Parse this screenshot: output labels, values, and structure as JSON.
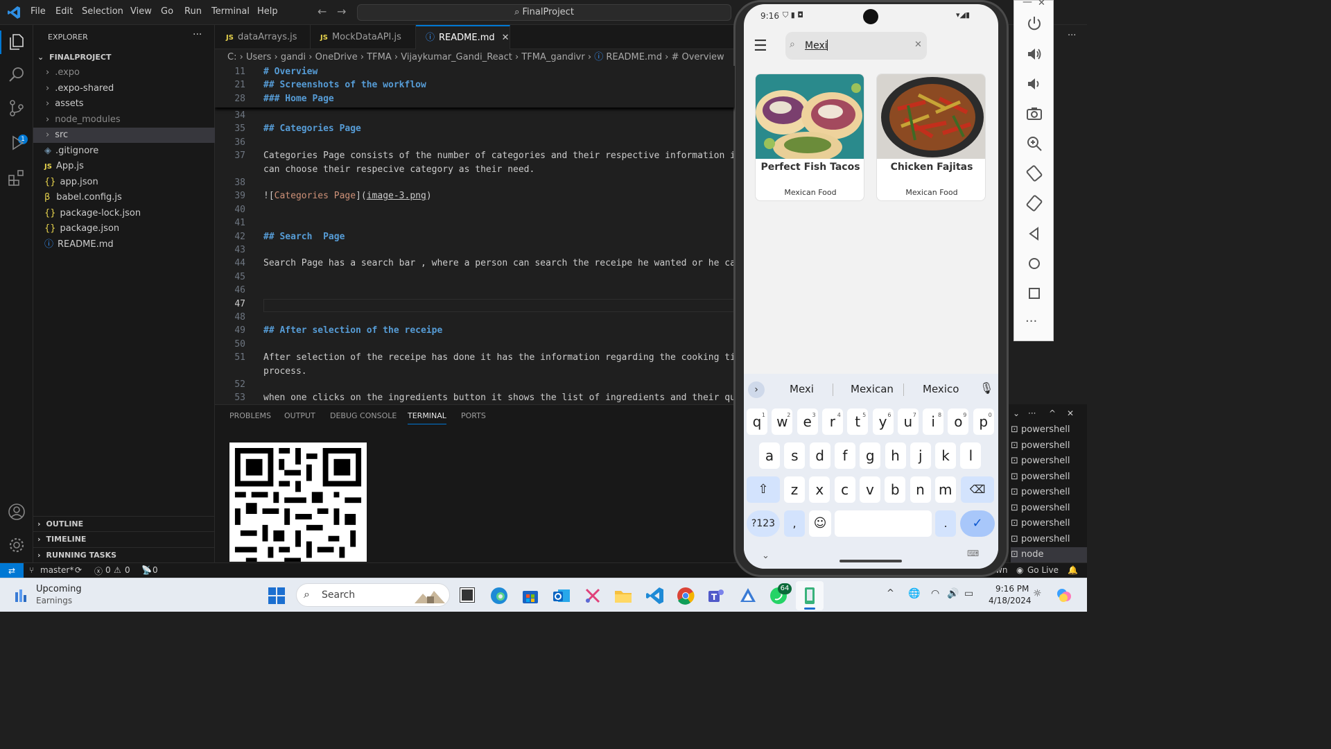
{
  "titlebar": {
    "menu": [
      "File",
      "Edit",
      "Selection",
      "View",
      "Go",
      "Run",
      "Terminal",
      "Help"
    ],
    "command_center": "FinalProject"
  },
  "sidebar": {
    "title": "EXPLORER",
    "project": "FINALPROJECT",
    "items": [
      {
        "label": ".expo",
        "type": "folder"
      },
      {
        "label": ".expo-shared",
        "type": "folder"
      },
      {
        "label": "assets",
        "type": "folder"
      },
      {
        "label": "node_modules",
        "type": "folder"
      },
      {
        "label": "src",
        "type": "folder"
      },
      {
        "label": ".gitignore",
        "type": "file"
      },
      {
        "label": "App.js",
        "type": "js"
      },
      {
        "label": "app.json",
        "type": "json"
      },
      {
        "label": "babel.config.js",
        "type": "babel"
      },
      {
        "label": "package-lock.json",
        "type": "json"
      },
      {
        "label": "package.json",
        "type": "json"
      },
      {
        "label": "README.md",
        "type": "info"
      }
    ],
    "sections": [
      "OUTLINE",
      "TIMELINE",
      "RUNNING TASKS"
    ]
  },
  "tabs": [
    {
      "label": "dataArrays.js",
      "icon": "JS"
    },
    {
      "label": "MockDataAPI.js",
      "icon": "JS"
    },
    {
      "label": "README.md",
      "icon": "ⓘ"
    }
  ],
  "breadcrumb": [
    "C:",
    "Users",
    "gandi",
    "OneDrive",
    "TFMA",
    "Vijaykumar_Gandi_React",
    "TFMA_gandivr",
    "README.md",
    "# Overview"
  ],
  "sticky": [
    {
      "n": "11",
      "t": "# Overview"
    },
    {
      "n": "21",
      "t": "## Screenshots of the workflow"
    },
    {
      "n": "28",
      "t": "### Home Page"
    }
  ],
  "editor_lines": [
    {
      "n": "34",
      "t": ""
    },
    {
      "n": "35",
      "t": "## Categories Page",
      "h": true
    },
    {
      "n": "36",
      "t": ""
    },
    {
      "n": "37",
      "t": "Categories Page consists of the number of categories and their respective information i"
    },
    {
      "n": "",
      "t": "can choose their respecive category as their need."
    },
    {
      "n": "38",
      "t": ""
    },
    {
      "n": "39",
      "t": "![Categories Page](image-3.png)"
    },
    {
      "n": "40",
      "t": ""
    },
    {
      "n": "41",
      "t": ""
    },
    {
      "n": "42",
      "t": "## Search  Page",
      "h": true
    },
    {
      "n": "43",
      "t": ""
    },
    {
      "n": "44",
      "t": "Search Page has a search bar , where a person can search the receipe he wanted or he ca"
    },
    {
      "n": "45",
      "t": ""
    },
    {
      "n": "46",
      "t": ""
    },
    {
      "n": "47",
      "t": ""
    },
    {
      "n": "48",
      "t": ""
    },
    {
      "n": "49",
      "t": "## After selection of the receipe",
      "h": true
    },
    {
      "n": "50",
      "t": ""
    },
    {
      "n": "51",
      "t": "After selection of the receipe has done it has the information regarding the cooking ti"
    },
    {
      "n": "",
      "t": "process."
    },
    {
      "n": "52",
      "t": ""
    },
    {
      "n": "53",
      "t": "when one clicks on the ingredients button it shows the list of ingredients and their qu"
    }
  ],
  "panel_tabs": [
    "PROBLEMS",
    "OUTPUT",
    "DEBUG CONSOLE",
    "TERMINAL",
    "PORTS"
  ],
  "terminals": [
    "powershell",
    "powershell",
    "powershell",
    "powershell",
    "powershell",
    "powershell",
    "powershell",
    "powershell",
    "node"
  ],
  "statusbar": {
    "branch": "master*",
    "errors": "0",
    "warnings": "0",
    "ports": "0",
    "golive": "Go Live",
    "wn": "wn"
  },
  "phone": {
    "time": "9:16",
    "search_value": "Mexi",
    "cards": [
      {
        "title": "Perfect Fish Tacos",
        "category": "Mexican Food"
      },
      {
        "title": "Chicken Fajitas",
        "category": "Mexican Food"
      }
    ],
    "suggestions": [
      "Mexi",
      "Mexican",
      "Mexico"
    ],
    "row1": [
      [
        "q",
        "1"
      ],
      [
        "w",
        "2"
      ],
      [
        "e",
        "3"
      ],
      [
        "r",
        "4"
      ],
      [
        "t",
        "5"
      ],
      [
        "y",
        "6"
      ],
      [
        "u",
        "7"
      ],
      [
        "i",
        "8"
      ],
      [
        "o",
        "9"
      ],
      [
        "p",
        "0"
      ]
    ],
    "row2": [
      "a",
      "s",
      "d",
      "f",
      "g",
      "h",
      "j",
      "k",
      "l"
    ],
    "row3": [
      "z",
      "x",
      "c",
      "v",
      "b",
      "n",
      "m"
    ],
    "sym_key": "?123",
    "comma": ",",
    "period": "."
  },
  "taskbar": {
    "widget_title": "Upcoming",
    "widget_sub": "Earnings",
    "search": "Search",
    "badge": "64",
    "time": "9:16 PM",
    "date": "4/18/2024"
  },
  "colors": {
    "accent": "#0078d4",
    "heading": "#569cd6",
    "link": "#ce9178",
    "keyboard_accent": "#a8c7fa"
  }
}
